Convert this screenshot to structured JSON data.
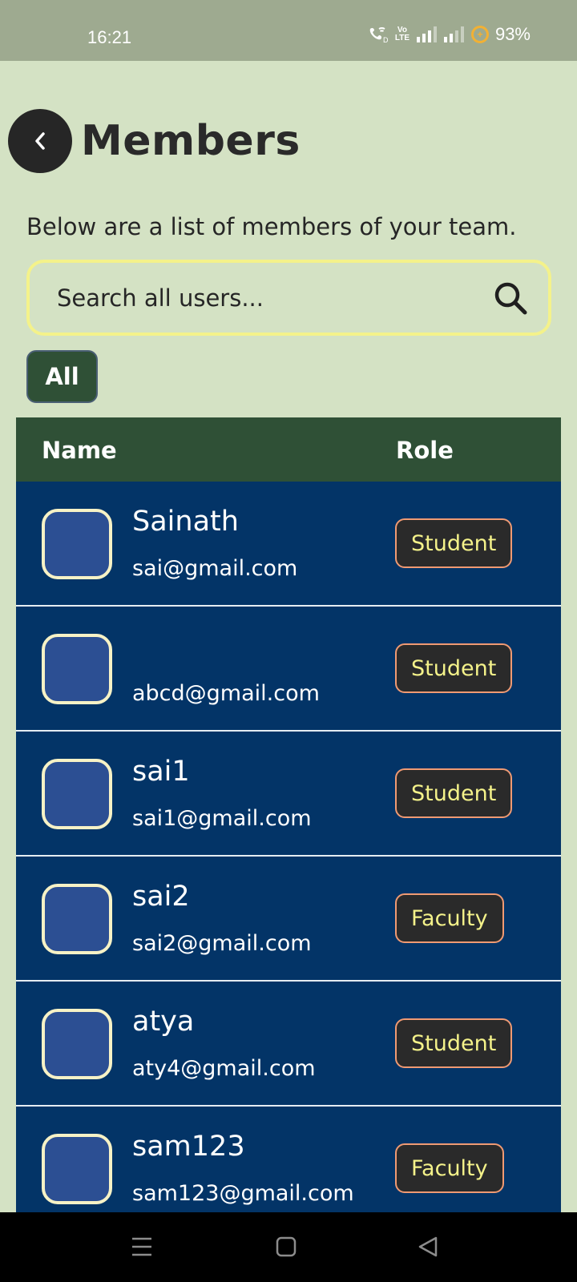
{
  "status_bar": {
    "time": "16:21",
    "battery": "93%",
    "volte": "Vo LTE",
    "icons": [
      "wifi-call-icon",
      "volte-icon",
      "signal-icon",
      "signal-icon",
      "battery-saver-icon"
    ]
  },
  "header": {
    "back_icon": "chevron-left-icon",
    "title": "Members",
    "subtitle": "Below are a list of members of your team."
  },
  "search": {
    "placeholder": "Search all users...",
    "value": "",
    "icon": "search-icon"
  },
  "filter": {
    "chip_label": "All"
  },
  "table": {
    "headers": {
      "name": "Name",
      "role": "Role"
    },
    "rows": [
      {
        "name": "Sainath",
        "email": "sai@gmail.com",
        "role": "Student"
      },
      {
        "name": "",
        "email": "abcd@gmail.com",
        "role": "Student"
      },
      {
        "name": "sai1",
        "email": "sai1@gmail.com",
        "role": "Student"
      },
      {
        "name": "sai2",
        "email": "sai2@gmail.com",
        "role": "Faculty"
      },
      {
        "name": "atya",
        "email": "aty4@gmail.com",
        "role": "Student"
      },
      {
        "name": "sam123",
        "email": "sam123@gmail.com",
        "role": "Faculty"
      }
    ]
  },
  "nav_bar": {
    "icons": [
      "menu-icon",
      "home-icon",
      "back-icon"
    ]
  },
  "colors": {
    "background": "#d4e2c4",
    "header_green": "#2f5036",
    "row_blue": "#033467",
    "badge_text": "#f4f28a",
    "badge_border": "#f09a73",
    "search_border": "#f4f28a"
  }
}
